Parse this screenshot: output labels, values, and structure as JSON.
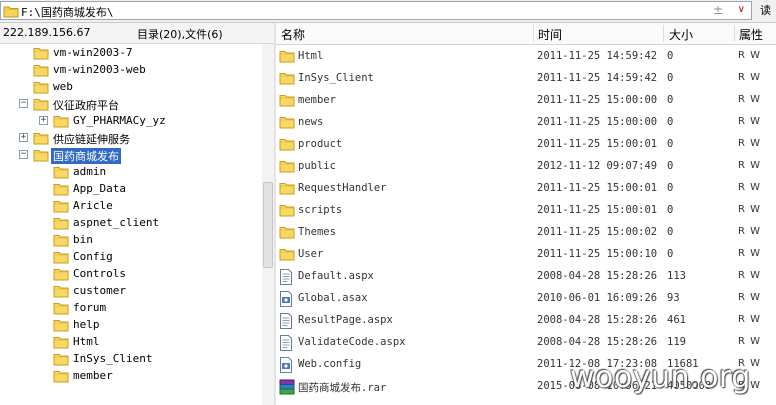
{
  "address_bar": {
    "path": "F:\\国药商城发布\\",
    "read_label": "读"
  },
  "left_pane": {
    "host": "222.189.156.67",
    "counts": "目录(20),文件(6)",
    "tree": [
      {
        "label": "vm-win2003-7",
        "indent": 0,
        "expander": "",
        "selected": false
      },
      {
        "label": "vm-win2003-web",
        "indent": 0,
        "expander": "",
        "selected": false
      },
      {
        "label": "web",
        "indent": 0,
        "expander": "",
        "selected": false
      },
      {
        "label": "仪征政府平台",
        "indent": 0,
        "expander": "-",
        "selected": false
      },
      {
        "label": "GY_PHARMACy_yz",
        "indent": 1,
        "expander": "+",
        "selected": false
      },
      {
        "label": "供应链延伸服务",
        "indent": 0,
        "expander": "+",
        "selected": false
      },
      {
        "label": "国药商城发布",
        "indent": 0,
        "expander": "-",
        "selected": true
      },
      {
        "label": "admin",
        "indent": 1,
        "expander": "",
        "selected": false
      },
      {
        "label": "App_Data",
        "indent": 1,
        "expander": "",
        "selected": false
      },
      {
        "label": "Aricle",
        "indent": 1,
        "expander": "",
        "selected": false
      },
      {
        "label": "aspnet_client",
        "indent": 1,
        "expander": "",
        "selected": false
      },
      {
        "label": "bin",
        "indent": 1,
        "expander": "",
        "selected": false
      },
      {
        "label": "Config",
        "indent": 1,
        "expander": "",
        "selected": false
      },
      {
        "label": "Controls",
        "indent": 1,
        "expander": "",
        "selected": false
      },
      {
        "label": "customer",
        "indent": 1,
        "expander": "",
        "selected": false
      },
      {
        "label": "forum",
        "indent": 1,
        "expander": "",
        "selected": false
      },
      {
        "label": "help",
        "indent": 1,
        "expander": "",
        "selected": false
      },
      {
        "label": "Html",
        "indent": 1,
        "expander": "",
        "selected": false
      },
      {
        "label": "InSys_Client",
        "indent": 1,
        "expander": "",
        "selected": false
      },
      {
        "label": "member",
        "indent": 1,
        "expander": "",
        "selected": false
      }
    ]
  },
  "file_list": {
    "columns": {
      "name": "名称",
      "time": "时间",
      "size": "大小",
      "attr": "属性"
    },
    "rows": [
      {
        "name": "Html",
        "time": "2011-11-25 14:59:42",
        "size": "0",
        "attr": "R W",
        "icon": "folder-icon"
      },
      {
        "name": "InSys_Client",
        "time": "2011-11-25 14:59:42",
        "size": "0",
        "attr": "R W",
        "icon": "folder-icon"
      },
      {
        "name": "member",
        "time": "2011-11-25 15:00:00",
        "size": "0",
        "attr": "R W",
        "icon": "folder-icon"
      },
      {
        "name": "news",
        "time": "2011-11-25 15:00:00",
        "size": "0",
        "attr": "R W",
        "icon": "folder-icon"
      },
      {
        "name": "product",
        "time": "2011-11-25 15:00:01",
        "size": "0",
        "attr": "R W",
        "icon": "folder-icon"
      },
      {
        "name": "public",
        "time": "2012-11-12 09:07:49",
        "size": "0",
        "attr": "R W",
        "icon": "folder-icon"
      },
      {
        "name": "RequestHandler",
        "time": "2011-11-25 15:00:01",
        "size": "0",
        "attr": "R W",
        "icon": "folder-icon"
      },
      {
        "name": "scripts",
        "time": "2011-11-25 15:00:01",
        "size": "0",
        "attr": "R W",
        "icon": "folder-icon"
      },
      {
        "name": "Themes",
        "time": "2011-11-25 15:00:02",
        "size": "0",
        "attr": "R W",
        "icon": "folder-icon"
      },
      {
        "name": "User",
        "time": "2011-11-25 15:00:10",
        "size": "0",
        "attr": "R W",
        "icon": "folder-icon"
      },
      {
        "name": "Default.aspx",
        "time": "2008-04-28 15:28:26",
        "size": "113",
        "attr": "R W",
        "icon": "document-icon"
      },
      {
        "name": "Global.asax",
        "time": "2010-06-01 16:09:26",
        "size": "93",
        "attr": "R W",
        "icon": "settings-file-icon"
      },
      {
        "name": "ResultPage.aspx",
        "time": "2008-04-28 15:28:26",
        "size": "461",
        "attr": "R W",
        "icon": "document-icon"
      },
      {
        "name": "ValidateCode.aspx",
        "time": "2008-04-28 15:28:26",
        "size": "119",
        "attr": "R W",
        "icon": "document-icon"
      },
      {
        "name": "Web.config",
        "time": "2011-12-08 17:23:08",
        "size": "11681",
        "attr": "R W",
        "icon": "settings-file-icon"
      },
      {
        "name": "国药商城发布.rar",
        "time": "2015-06-08 10:56:21",
        "size": "4050008",
        "attr": "R W",
        "icon": "archive-icon"
      }
    ]
  },
  "watermark": "wooyun.org"
}
